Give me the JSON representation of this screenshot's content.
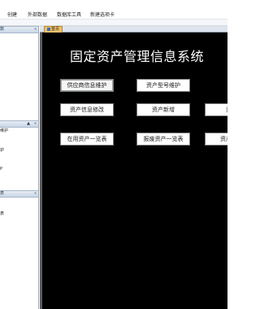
{
  "ribbon": {
    "tabs": [
      "创建",
      "外部数据",
      "数据库工具",
      "新建选项卡"
    ]
  },
  "nav_pane": {
    "groups": [
      {
        "label": "数",
        "collapse": "«"
      },
      {
        "label": "",
        "collapse": "«",
        "pin": "▲"
      },
      {
        "label": "表",
        "collapse": "«"
      }
    ],
    "fragments": [
      "维护",
      "护",
      "P",
      "表"
    ]
  },
  "document": {
    "tab_label": "首页"
  },
  "form": {
    "title": "固定资产管理信息系统",
    "buttons": [
      {
        "label": "供应商信息维护",
        "selected": true
      },
      {
        "label": "资产型号维护",
        "selected": false
      },
      {
        "label": "资产信息修改",
        "selected": false
      },
      {
        "label": "资产新增",
        "selected": false
      },
      {
        "label": "资产",
        "selected": false
      },
      {
        "label": "在用资产一览表",
        "selected": false
      },
      {
        "label": "报废资产一览表",
        "selected": false
      },
      {
        "label": "资产采购",
        "selected": false
      }
    ]
  }
}
